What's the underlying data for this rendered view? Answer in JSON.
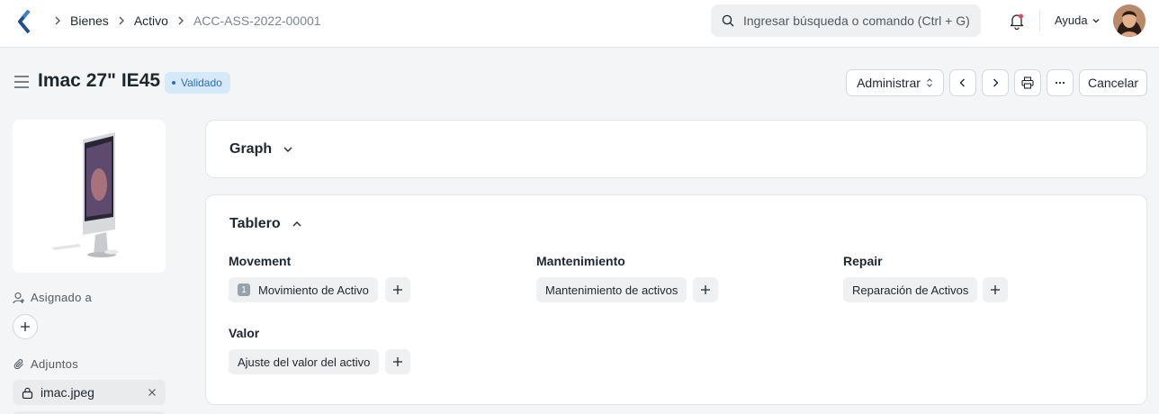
{
  "navbar": {
    "breadcrumbs": [
      "Bienes",
      "Activo",
      "ACC-ASS-2022-00001"
    ],
    "search_placeholder": "Ingresar búsqueda o comando (Ctrl + G)",
    "help_label": "Ayuda",
    "icons": [
      "app-logo-icon",
      "chevron-right-icon",
      "search-icon",
      "bell-icon",
      "chevron-down-icon",
      "avatar"
    ]
  },
  "page": {
    "title": "Imac 27\" IE45",
    "status": "Validado",
    "status_color": "#2a6ebd",
    "actions": {
      "manage": "Administrar",
      "cancel": "Cancelar"
    }
  },
  "sidebar": {
    "assigned_label": "Asignado a",
    "attachments_label": "Adjuntos",
    "attachments": [
      {
        "name": "imac.jpeg"
      }
    ]
  },
  "sections": {
    "graph": {
      "title": "Graph"
    },
    "dashboard": {
      "title": "Tablero",
      "groups": [
        {
          "label": "Movement",
          "link": "Movimiento de Activo",
          "count": "1"
        },
        {
          "label": "Mantenimiento",
          "link": "Mantenimiento de activos"
        },
        {
          "label": "Repair",
          "link": "Reparación de Activos"
        },
        {
          "label": "Valor",
          "link": "Ajuste del valor del activo"
        }
      ]
    }
  }
}
